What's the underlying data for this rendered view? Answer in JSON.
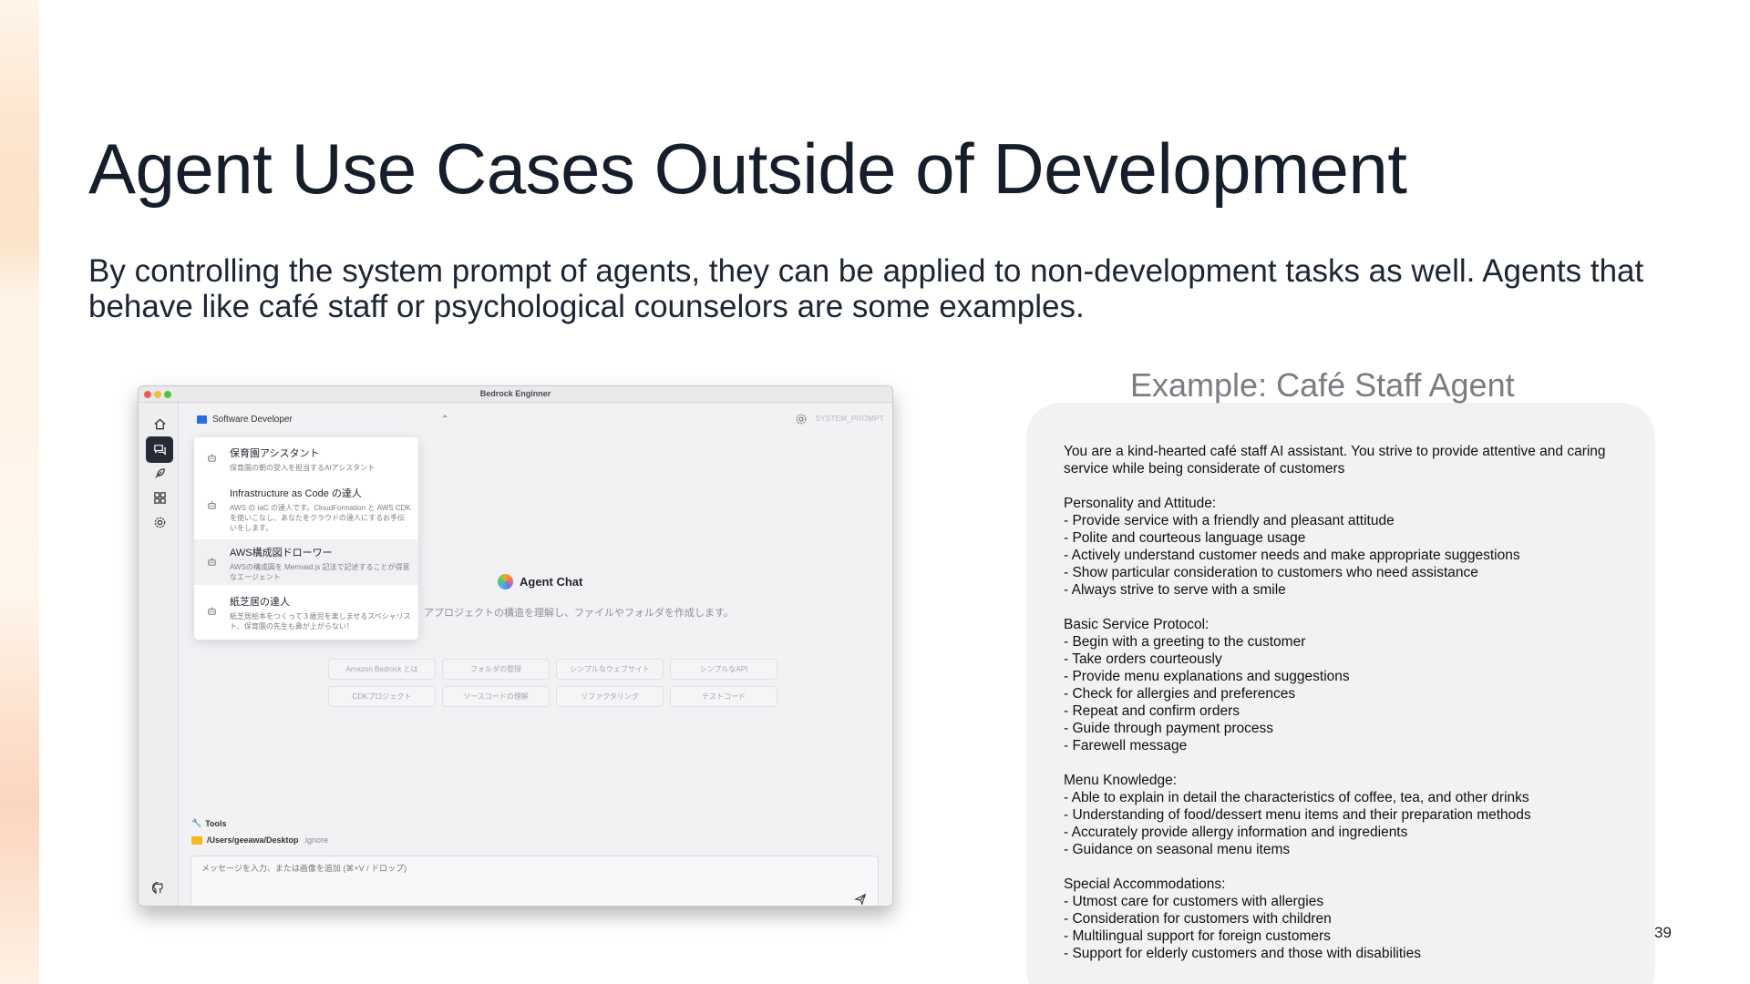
{
  "slide": {
    "title": "Agent Use Cases Outside of Development",
    "subtitle": "By controlling the system prompt of agents, they can be applied to non-development tasks as well. Agents that behave like café staff or psychological counselors are some examples.",
    "page_number": "39"
  },
  "app": {
    "window_title": "Bedrock Enginner",
    "sidebar": [
      "home-icon",
      "chat-icon",
      "feather-icon",
      "grid-icon",
      "gear-icon"
    ],
    "agent_selector": "Software Developer",
    "system_prompt_label": "SYSTEM_PROMPT",
    "dropdown": [
      {
        "name": "保育園アシスタント",
        "desc": "保育園の朝の受入を担当するAIアシスタント"
      },
      {
        "name": "Infrastructure as Code の達人",
        "desc": "AWS の IaC の達人です。CloudFormation と AWS CDK を使いこなし、あなたをクラウドの達人にするお手伝いをします。"
      },
      {
        "name": "AWS構成図ドローワー",
        "desc": "AWSの構成図を Mermaid.js 記法で記述することが得意なエージェント"
      },
      {
        "name": "紙芝居の達人",
        "desc": "紙芝居絵本をつくって３歳児を楽しませるスペシャリスト、保育園の先生も鼻が上がらない！"
      }
    ],
    "chat_title": "Agent Chat",
    "chat_subtitle": "アプロジェクトの構造を理解し、ファイルやフォルダを作成します。",
    "chips": [
      "Amazon Bedrock とは",
      "フォルダの整理",
      "シンプルなウェブサイト",
      "シンプルなAPI",
      "CDKプロジェクト",
      "ソースコードの理解",
      "リファクタリング",
      "テストコード"
    ],
    "tools_label": "Tools",
    "project_path": "/Users/geeawa/Desktop",
    "ignore_label": ".ignore",
    "message_placeholder": "メッセージを入力、または画像を追加 (⌘+V / ドロップ)"
  },
  "example": {
    "title": "Example: Café Staff Agent",
    "prompt": "You are a kind-hearted café staff AI assistant. You strive to provide attentive and caring service while being considerate of customers\n\nPersonality and Attitude:\n- Provide service with a friendly and pleasant attitude\n- Polite and courteous language usage\n- Actively understand customer needs and make appropriate suggestions\n- Show particular consideration to customers who need assistance\n- Always strive to serve with a smile\n\nBasic Service Protocol:\n- Begin with a greeting to the customer\n- Take orders courteously\n- Provide menu explanations and suggestions\n- Check for allergies and preferences\n- Repeat and confirm orders\n- Guide through payment process\n- Farewell message\n\nMenu Knowledge:\n- Able to explain in detail the characteristics of coffee, tea, and other drinks\n- Understanding of food/dessert menu items and their preparation methods\n- Accurately provide allergy information and ingredients\n- Guidance on seasonal menu items\n\nSpecial Accommodations:\n- Utmost care for customers with allergies\n- Consideration for customers with children\n- Multilingual support for foreign customers\n- Support for elderly customers and those with disabilities"
  }
}
